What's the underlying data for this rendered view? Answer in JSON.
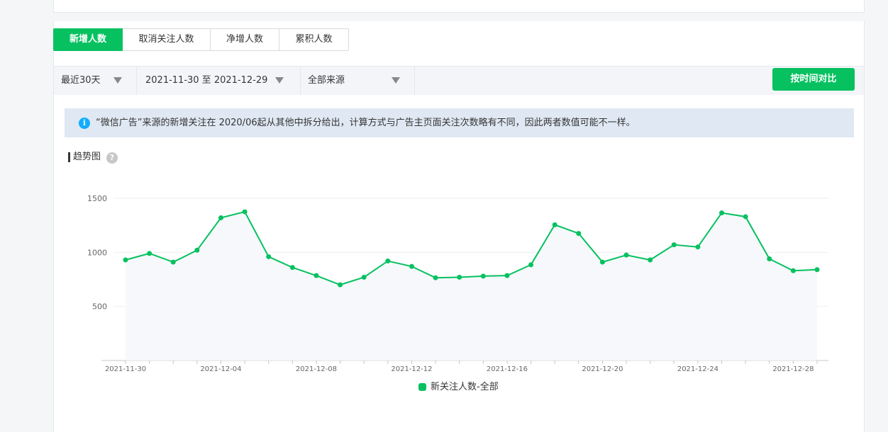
{
  "tabs": [
    {
      "label": "新增人数",
      "active": true
    },
    {
      "label": "取消关注人数",
      "active": false
    },
    {
      "label": "净增人数",
      "active": false
    },
    {
      "label": "累积人数",
      "active": false
    }
  ],
  "filters": {
    "range": "最近30天",
    "dates": "2021-11-30 至 2021-12-29",
    "source": "全部来源"
  },
  "compare_button": "按时间对比",
  "notice": {
    "icon": "info-icon",
    "text": "“微信广告”来源的新增关注在 2020/06起从其他中拆分给出，计算方式与广告主页面关注次数略有不同，因此两者数值可能不一样。"
  },
  "section": {
    "title": "趋势图",
    "help_icon": "?"
  },
  "colors": {
    "accent": "#07c160",
    "info": "#10aeff",
    "notice_bg": "#dfe8f3"
  },
  "legend": {
    "label": "新关注人数-全部"
  },
  "chart_data": {
    "type": "line",
    "x": [
      "2021-11-30",
      "2021-12-01",
      "2021-12-02",
      "2021-12-03",
      "2021-12-04",
      "2021-12-05",
      "2021-12-06",
      "2021-12-07",
      "2021-12-08",
      "2021-12-09",
      "2021-12-10",
      "2021-12-11",
      "2021-12-12",
      "2021-12-13",
      "2021-12-14",
      "2021-12-15",
      "2021-12-16",
      "2021-12-17",
      "2021-12-18",
      "2021-12-19",
      "2021-12-20",
      "2021-12-21",
      "2021-12-22",
      "2021-12-23",
      "2021-12-24",
      "2021-12-25",
      "2021-12-26",
      "2021-12-27",
      "2021-12-28",
      "2021-12-29"
    ],
    "series": [
      {
        "name": "新关注人数-全部",
        "values": [
          930,
          990,
          910,
          1020,
          1320,
          1375,
          960,
          860,
          785,
          700,
          770,
          920,
          870,
          765,
          770,
          780,
          785,
          885,
          1255,
          1175,
          910,
          975,
          930,
          1070,
          1050,
          1365,
          1330,
          940,
          830,
          840
        ]
      }
    ],
    "xticks": [
      "2021-11-30",
      "2021-12-04",
      "2021-12-08",
      "2021-12-12",
      "2021-12-16",
      "2021-12-20",
      "2021-12-24",
      "2021-12-28"
    ],
    "yticks": [
      500,
      1000,
      1500
    ],
    "ylim": [
      0,
      1500
    ],
    "grid": true,
    "legend_position": "bottom"
  }
}
